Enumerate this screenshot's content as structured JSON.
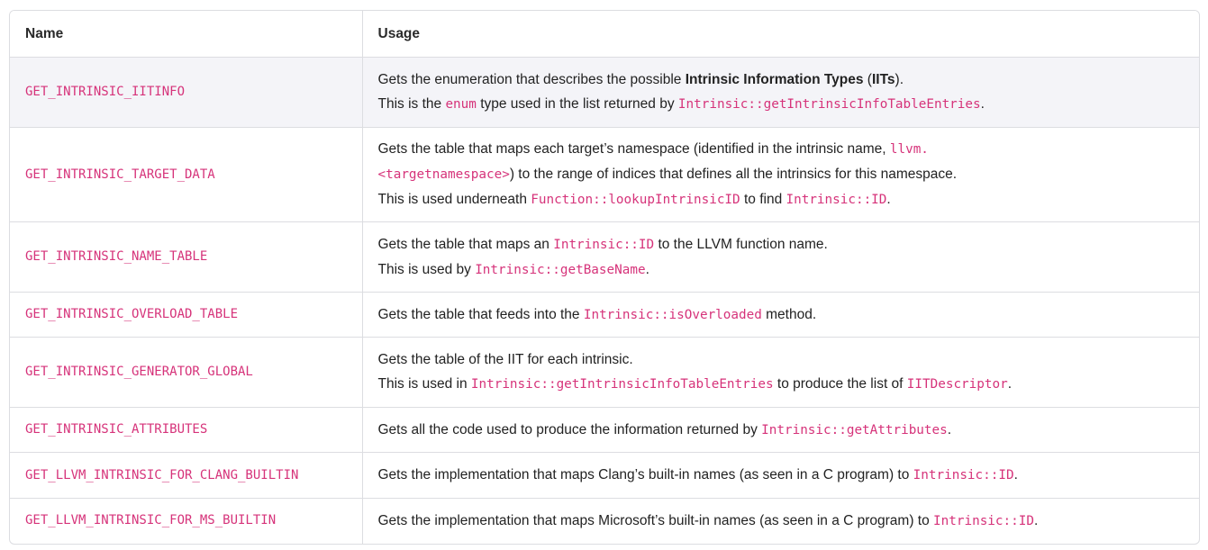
{
  "header": {
    "name": "Name",
    "usage": "Usage"
  },
  "rows": [
    {
      "name": "GET_INTRINSIC_IITINFO",
      "u0a": "Gets the enumeration that describes the possible ",
      "u0b": "Intrinsic Information Types",
      "u0c": " (",
      "u0d": "IITs",
      "u0e": ").",
      "u1a": "This is the ",
      "u1b": "enum",
      "u1c": " type used in the list returned by ",
      "u1d": "Intrinsic::getIntrinsicInfoTableEntries",
      "u1e": "."
    },
    {
      "name": "GET_INTRINSIC_TARGET_DATA",
      "u0a": "Gets the table that maps each target’s namespace (identified in the intrinsic name, ",
      "u0b": "llvm.",
      "u1a": "<targetnamespace>",
      "u1b": ") to the range of indices that defines all the intrinsics for this namespace.",
      "u2a": "This is used underneath ",
      "u2b": "Function::lookupIntrinsicID",
      "u2c": " to find ",
      "u2d": "Intrinsic::ID",
      "u2e": "."
    },
    {
      "name": "GET_INTRINSIC_NAME_TABLE",
      "u0a": "Gets the table that maps an ",
      "u0b": "Intrinsic::ID",
      "u0c": " to the LLVM function name.",
      "u1a": "This is used by ",
      "u1b": "Intrinsic::getBaseName",
      "u1c": "."
    },
    {
      "name": "GET_INTRINSIC_OVERLOAD_TABLE",
      "u0a": "Gets the table that feeds into the ",
      "u0b": "Intrinsic::isOverloaded",
      "u0c": " method."
    },
    {
      "name": "GET_INTRINSIC_GENERATOR_GLOBAL",
      "u0a": "Gets the table of the IIT for each intrinsic.",
      "u1a": "This is used in ",
      "u1b": "Intrinsic::getIntrinsicInfoTableEntries",
      "u1c": " to produce the list of ",
      "u1d": "IITDescriptor",
      "u1e": "."
    },
    {
      "name": "GET_INTRINSIC_ATTRIBUTES",
      "u0a": "Gets all the code used to produce the information returned by ",
      "u0b": "Intrinsic::getAttributes",
      "u0c": "."
    },
    {
      "name": "GET_LLVM_INTRINSIC_FOR_CLANG_BUILTIN",
      "u0a": "Gets the implementation that maps Clang’s built-in names (as seen in a C program) to ",
      "u0b": "Intrinsic::ID",
      "u0c": "."
    },
    {
      "name": "GET_LLVM_INTRINSIC_FOR_MS_BUILTIN",
      "u0a": "Gets the implementation that maps Microsoft’s built-in names (as seen in a C program) to ",
      "u0b": "Intrinsic::ID",
      "u0c": "."
    }
  ]
}
